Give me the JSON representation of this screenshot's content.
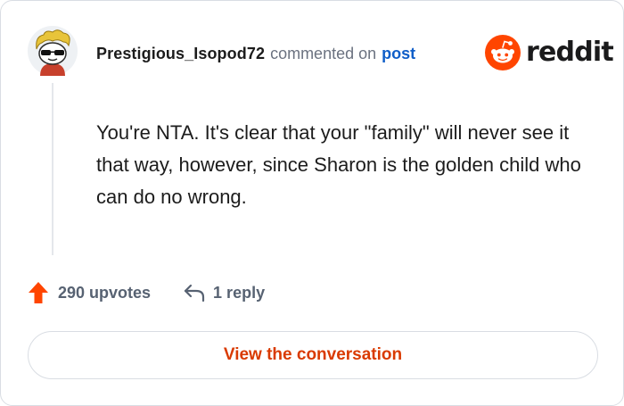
{
  "comment": {
    "username": "Prestigious_Isopod72",
    "action_text": "commented on",
    "post_link": "post",
    "body": "You're NTA. It's clear that your \"family\" will never see it that way, however, since Sharon is the golden child who can do no wrong."
  },
  "brand": {
    "name": "reddit",
    "icon": "reddit-snoo-icon",
    "accent": "#ff4500"
  },
  "stats": {
    "upvotes": "290 upvotes",
    "replies": "1 reply",
    "upvote_icon": "upvote-arrow-icon",
    "reply_icon": "reply-arrow-icon"
  },
  "cta": {
    "label": "View the conversation"
  },
  "colors": {
    "username": "#1c1c1c",
    "muted": "#6b7280",
    "link": "#0f5ec8",
    "upvote": "#ff4500",
    "cta_text": "#d93a00",
    "border": "#d9dde3"
  }
}
